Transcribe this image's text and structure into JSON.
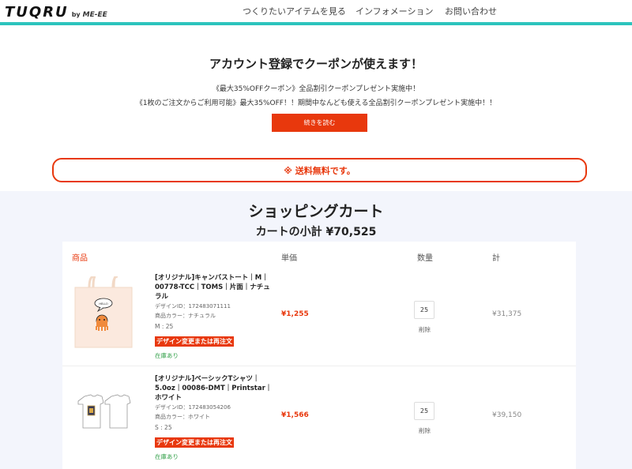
{
  "header": {
    "logo_main": "TUQRU",
    "logo_by": "by",
    "logo_sub": "ME-EE",
    "nav": [
      {
        "label": "つくりたいアイテムを見る"
      },
      {
        "label": "インフォメーション"
      },
      {
        "label": "お問い合わせ"
      }
    ]
  },
  "promo": {
    "title": "アカウント登録でクーポンが使えます！",
    "line1": "《最大35%OFFクーポン》全品割引クーポンプレゼント実施中！",
    "line2": "《1枚のご注文からご利用可能》最大35%OFF！！期間中なんども使える全品割引クーポンプレゼント実施中！！",
    "read_more_label": "続きを読む"
  },
  "shipping_banner": "※ 送料無料です。",
  "cart": {
    "title": "ショッピングカート",
    "subtotal": "カートの小計 ¥70,525",
    "columns": {
      "product": "商品",
      "unit_price": "単価",
      "quantity": "数量",
      "total": "計"
    },
    "items": [
      {
        "name": "[オリジナル]キャンバストート｜M｜00778-TCC｜TOMS｜片面｜ナチュラル",
        "design_id": "デザインID：172483071111",
        "color": "商品カラー：ナチュラル",
        "size": "M : 25",
        "change_label": "デザイン変更または再注文",
        "stock": "在庫あり",
        "unit_price": "¥1,255",
        "quantity": "25",
        "delete_label": "削除",
        "line_total": "¥31,375",
        "bubble_text": "HELLO"
      },
      {
        "name": "[オリジナル]ベーシックTシャツ｜5.0oz｜00086-DMT｜Printstar｜ホワイト",
        "design_id": "デザインID：172483054206",
        "color": "商品カラー：ホワイト",
        "size": "S : 25",
        "change_label": "デザイン変更または再注文",
        "stock": "在庫あり",
        "unit_price": "¥1,566",
        "quantity": "25",
        "delete_label": "削除",
        "line_total": "¥39,150"
      }
    ]
  },
  "colors": {
    "accent_red": "#e8380d",
    "teal_bar": "#2cc4bd",
    "stock_green": "#33a04a",
    "cart_bg": "#f3f5fc"
  }
}
